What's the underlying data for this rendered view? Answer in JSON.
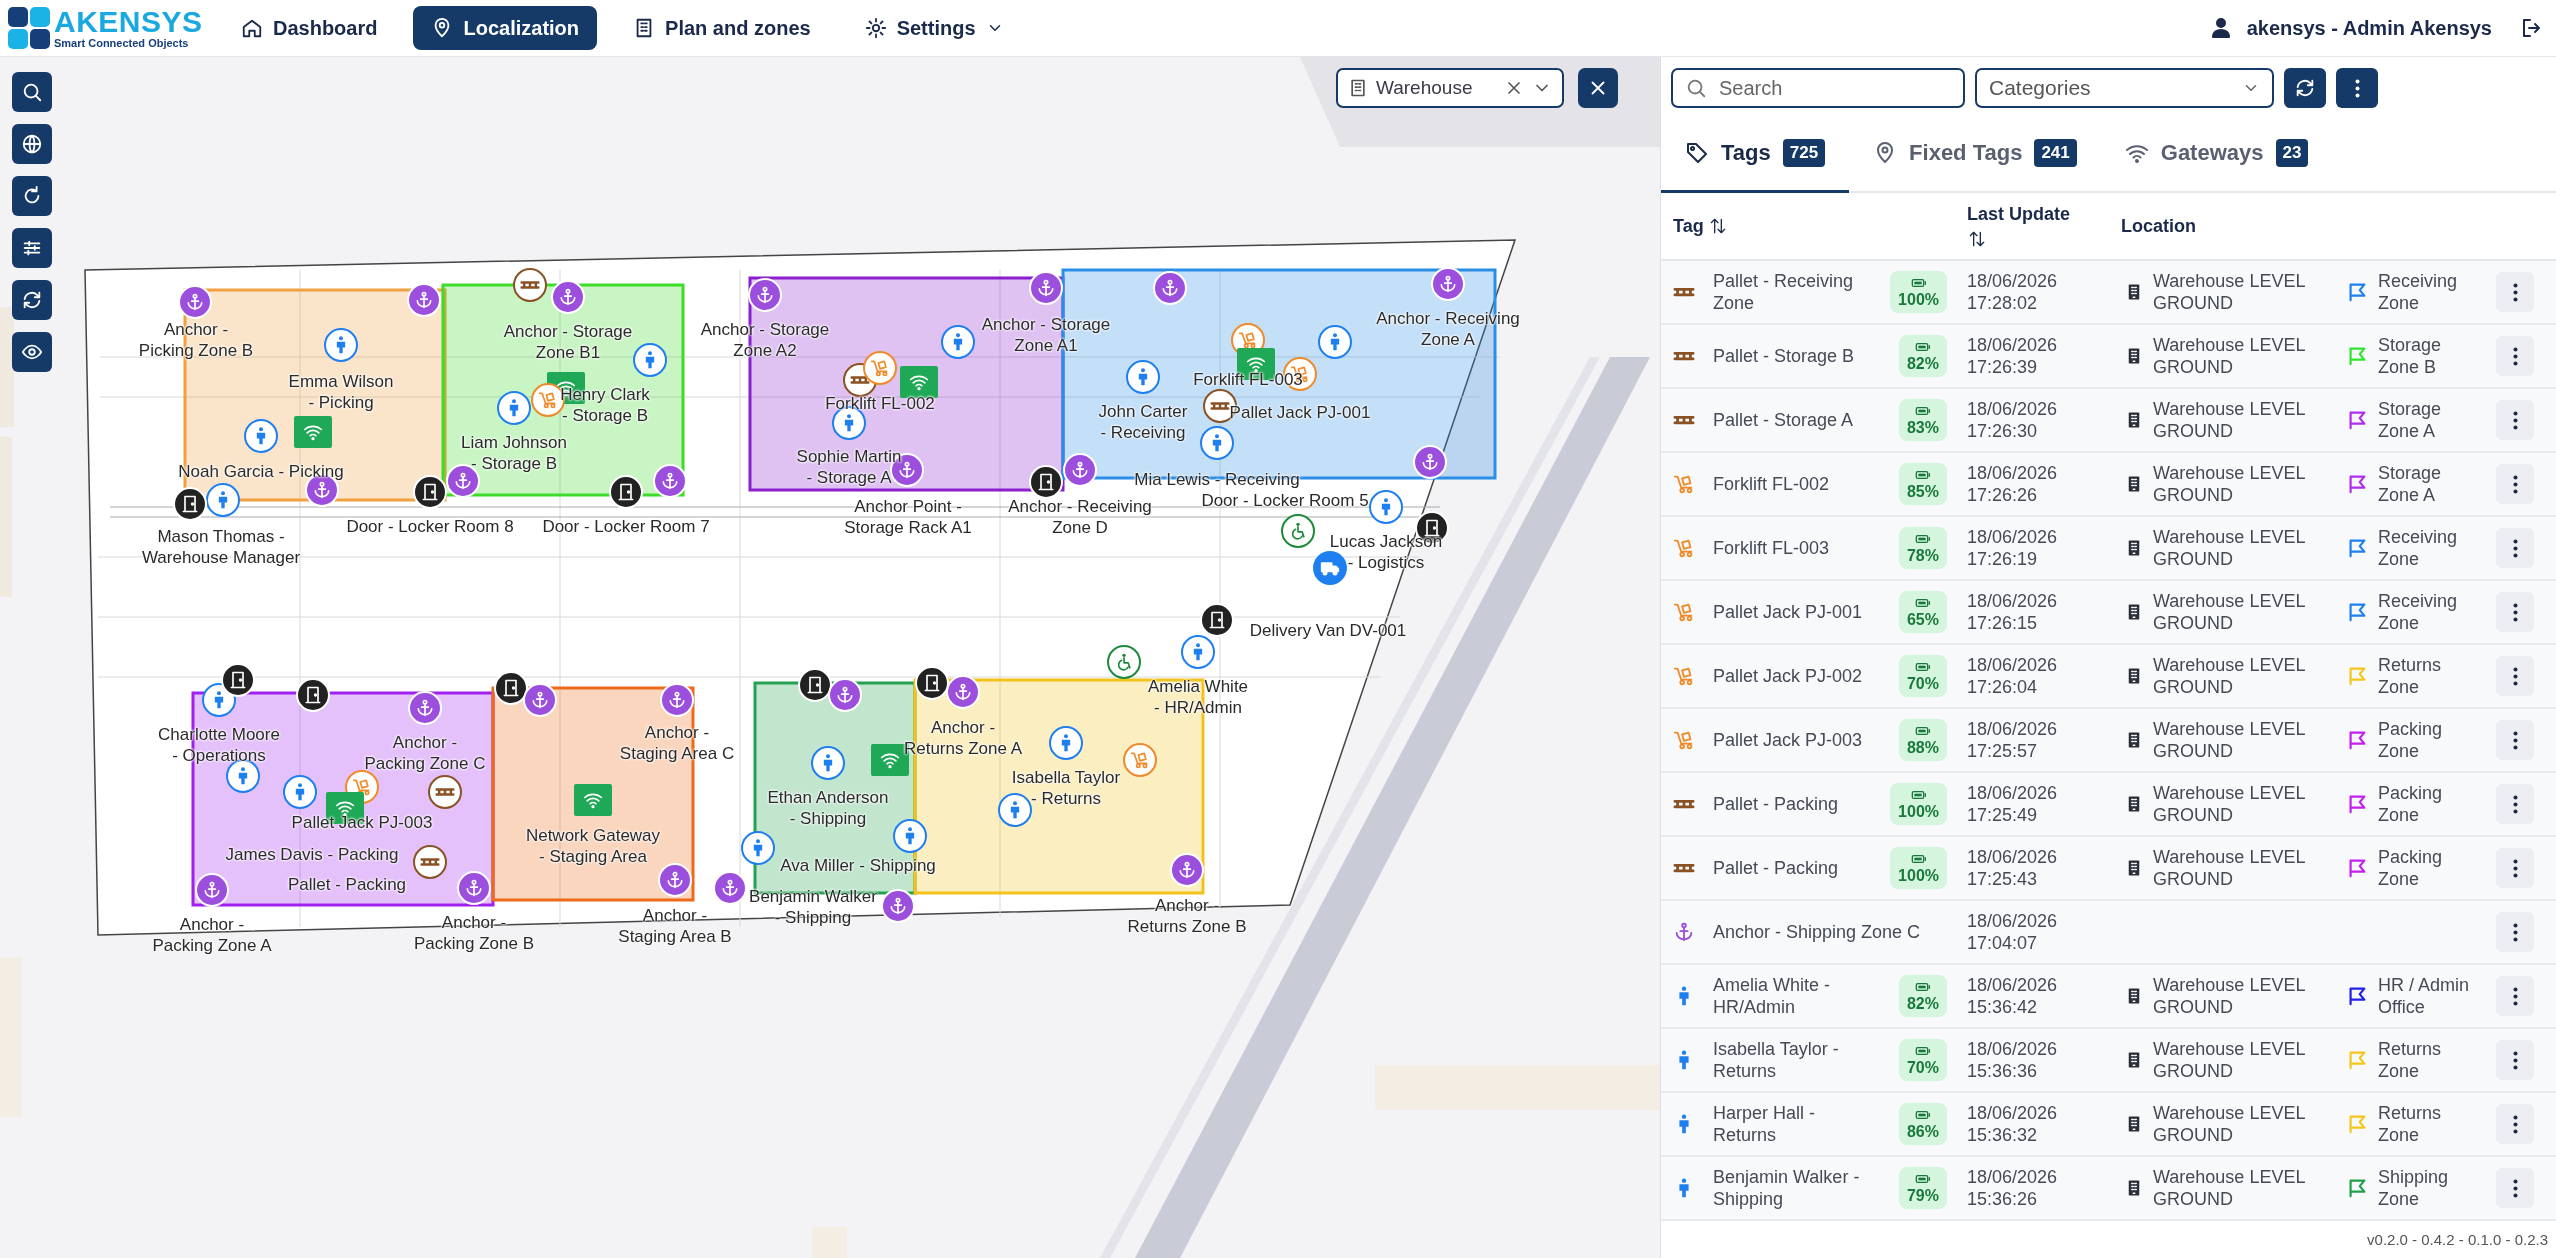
{
  "header": {
    "logo": {
      "name": "AKENSYS",
      "tagline": "Smart Connected Objects"
    },
    "nav": [
      {
        "kind": "home",
        "label": "Dashboard",
        "selected": false
      },
      {
        "kind": "pin",
        "label": "Localization",
        "selected": true
      },
      {
        "kind": "building",
        "label": "Plan and zones",
        "selected": false
      },
      {
        "kind": "gear",
        "label": "Settings",
        "selected": false,
        "dropdown": true
      }
    ],
    "user": "akensys - Admin Akensys"
  },
  "map_tools": [
    {
      "kind": "search"
    },
    {
      "kind": "globe"
    },
    {
      "kind": "rotate"
    },
    {
      "kind": "sliders"
    },
    {
      "kind": "sync"
    },
    {
      "kind": "eye"
    }
  ],
  "building_filter": {
    "value": "Warehouse"
  },
  "zones": [
    {
      "color": "#f0a040"
    },
    {
      "color": "#3ddc2a"
    },
    {
      "color": "#8b1fd0"
    },
    {
      "color": "#2a8de6"
    },
    {
      "color": "#a020f0"
    },
    {
      "color": "#ee6a1a"
    },
    {
      "color": "#23a050"
    },
    {
      "color": "#f2c21b"
    }
  ],
  "markers": [
    {
      "kind": "anchor",
      "label": "Anchor -\nPicking Zone B"
    },
    {
      "kind": "anchor",
      "label": "Anchor - Storage\nZone B1"
    },
    {
      "kind": "anchor",
      "label": "Anchor - Storage\nZone A2"
    },
    {
      "kind": "anchor",
      "label": "Anchor - Storage\nZone A1"
    },
    {
      "kind": "anchor",
      "label": "Anchor - Receiving\nZone A"
    },
    {
      "kind": "person",
      "label": "Emma Wilson\n- Picking"
    },
    {
      "kind": "person",
      "label": "Henry Clark\n- Storage B"
    },
    {
      "kind": "pallet",
      "label": "Forklift FL-002"
    },
    {
      "kind": "forklift",
      "label": "Forklift FL-003"
    },
    {
      "kind": "person",
      "label": "John Carter\n- Receiving"
    },
    {
      "kind": "pallet",
      "label": "Pallet Jack PJ-001"
    },
    {
      "kind": "person",
      "label": "Noah Garcia - Picking"
    },
    {
      "kind": "person",
      "label": "Liam Johnson\n- Storage B"
    },
    {
      "kind": "person",
      "label": "Sophie Martin\n- Storage A"
    },
    {
      "kind": "person",
      "label": "Mia Lewis - Receiving"
    },
    {
      "kind": "anchor",
      "label": "Anchor Point -\nStorage Rack A1"
    },
    {
      "kind": "anchor",
      "label": "Anchor - Receiving\nZone D"
    },
    {
      "kind": "door",
      "label": "Door - Locker Room 5"
    },
    {
      "kind": "person",
      "label": "Mason Thomas -\nWarehouse Manager"
    },
    {
      "kind": "door",
      "label": "Door - Locker Room 8"
    },
    {
      "kind": "door",
      "label": "Door - Locker Room 7"
    },
    {
      "kind": "person",
      "label": "Lucas Jackson\n- Logistics"
    },
    {
      "kind": "door",
      "label": "Delivery Van DV-001"
    },
    {
      "kind": "person",
      "label": "Amelia White\n- HR/Admin"
    },
    {
      "kind": "person",
      "label": "Charlotte Moore\n- Operations"
    },
    {
      "kind": "anchor",
      "label": "Anchor -\nPacking Zone C"
    },
    {
      "kind": "anchor",
      "label": "Anchor -\nStaging Area C"
    },
    {
      "kind": "anchor",
      "label": "Anchor -\nReturns Zone A"
    },
    {
      "kind": "person",
      "label": "Ethan Anderson\n- Shipping"
    },
    {
      "kind": "person",
      "label": "Isabella Taylor\n- Returns"
    },
    {
      "kind": "forklift",
      "label": "Pallet Jack PJ-003"
    },
    {
      "kind": "person",
      "label": "James Davis - Packing"
    },
    {
      "kind": "gateway",
      "label": "Network Gateway\n- Staging Area"
    },
    {
      "kind": "person",
      "label": "Ava Miller - Shipping"
    },
    {
      "kind": "pallet",
      "label": "Pallet - Packing"
    },
    {
      "kind": "anchor",
      "label": "Benjamin Walker\n- Shipping"
    },
    {
      "kind": "anchor",
      "label": "Anchor -\nPacking Zone A"
    },
    {
      "kind": "anchor",
      "label": "Anchor -\nPacking Zone B"
    },
    {
      "kind": "anchor",
      "label": "Anchor -\nStaging Area B"
    },
    {
      "kind": "anchor",
      "label": "Anchor -\nReturns Zone B"
    },
    {
      "kind": "pallet"
    },
    {
      "kind": "anchor"
    },
    {
      "kind": "anchor"
    },
    {
      "kind": "gateway"
    },
    {
      "kind": "person"
    },
    {
      "kind": "gateway"
    },
    {
      "kind": "forklift"
    },
    {
      "kind": "person"
    },
    {
      "kind": "forklift"
    },
    {
      "kind": "gateway"
    },
    {
      "kind": "gateway"
    },
    {
      "kind": "forklift"
    },
    {
      "kind": "person"
    },
    {
      "kind": "anchor"
    },
    {
      "kind": "anchor"
    },
    {
      "kind": "door"
    },
    {
      "kind": "anchor"
    },
    {
      "kind": "door"
    },
    {
      "kind": "anchor"
    },
    {
      "kind": "wheelchair"
    },
    {
      "kind": "truck"
    },
    {
      "kind": "wheelchair"
    },
    {
      "kind": "door"
    },
    {
      "kind": "door"
    },
    {
      "kind": "door"
    },
    {
      "kind": "anchor"
    },
    {
      "kind": "door"
    },
    {
      "kind": "anchor"
    },
    {
      "kind": "door"
    },
    {
      "kind": "person"
    },
    {
      "kind": "gateway"
    },
    {
      "kind": "pallet"
    },
    {
      "kind": "gateway"
    },
    {
      "kind": "forklift"
    },
    {
      "kind": "person"
    },
    {
      "kind": "anchor"
    }
  ],
  "panel": {
    "search": {
      "placeholder": "Search"
    },
    "categories": {
      "placeholder": "Categories"
    },
    "tabs": [
      {
        "kind": "tag",
        "label": "Tags",
        "count": "725",
        "selected": true
      },
      {
        "kind": "pin",
        "label": "Fixed Tags",
        "count": "241",
        "selected": false
      },
      {
        "kind": "wifi",
        "label": "Gateways",
        "count": "23",
        "selected": false
      }
    ],
    "columns": [
      "Tag",
      "Last Update",
      "Location"
    ],
    "rows": [
      {
        "kind": "pallet",
        "name": "Pallet - Receiving Zone",
        "battery": "100%",
        "updated": "18/06/2026 17:28:02",
        "location": "Warehouse LEVEL GROUND",
        "zone": "Receiving Zone",
        "color": "#1e7ff0"
      },
      {
        "kind": "pallet",
        "name": "Pallet - Storage B",
        "battery": "82%",
        "updated": "18/06/2026 17:26:39",
        "location": "Warehouse LEVEL GROUND",
        "zone": "Storage Zone B",
        "color": "#2ee52e"
      },
      {
        "kind": "pallet",
        "name": "Pallet - Storage A",
        "battery": "83%",
        "updated": "18/06/2026 17:26:30",
        "location": "Warehouse LEVEL GROUND",
        "zone": "Storage Zone A",
        "color": "#b02cf0"
      },
      {
        "kind": "forklift",
        "name": "Forklift FL-002",
        "battery": "85%",
        "updated": "18/06/2026 17:26:26",
        "location": "Warehouse LEVEL GROUND",
        "zone": "Storage Zone A",
        "color": "#b02cf0"
      },
      {
        "kind": "forklift",
        "name": "Forklift FL-003",
        "battery": "78%",
        "updated": "18/06/2026 17:26:19",
        "location": "Warehouse LEVEL GROUND",
        "zone": "Receiving Zone",
        "color": "#1e7ff0"
      },
      {
        "kind": "forklift",
        "name": "Pallet Jack PJ-001",
        "battery": "65%",
        "updated": "18/06/2026 17:26:15",
        "location": "Warehouse LEVEL GROUND",
        "zone": "Receiving Zone",
        "color": "#1e7ff0"
      },
      {
        "kind": "forklift",
        "name": "Pallet Jack PJ-002",
        "battery": "70%",
        "updated": "18/06/2026 17:26:04",
        "location": "Warehouse LEVEL GROUND",
        "zone": "Returns Zone",
        "color": "#f5c518"
      },
      {
        "kind": "forklift",
        "name": "Pallet Jack PJ-003",
        "battery": "88%",
        "updated": "18/06/2026 17:25:57",
        "location": "Warehouse LEVEL GROUND",
        "zone": "Packing Zone",
        "color": "#c21ff0"
      },
      {
        "kind": "pallet",
        "name": "Pallet - Packing",
        "battery": "100%",
        "updated": "18/06/2026 17:25:49",
        "location": "Warehouse LEVEL GROUND",
        "zone": "Packing Zone",
        "color": "#c21ff0"
      },
      {
        "kind": "pallet",
        "name": "Pallet - Packing",
        "battery": "100%",
        "updated": "18/06/2026 17:25:43",
        "location": "Warehouse LEVEL GROUND",
        "zone": "Packing Zone",
        "color": "#c21ff0"
      },
      {
        "kind": "anchor",
        "name": "Anchor - Shipping Zone C",
        "updated": "18/06/2026 17:04:07"
      },
      {
        "kind": "person",
        "name": "Amelia White - HR/Admin",
        "battery": "82%",
        "updated": "18/06/2026 15:36:42",
        "location": "Warehouse LEVEL GROUND",
        "zone": "HR / Admin Office",
        "color": "#2020e8"
      },
      {
        "kind": "person",
        "name": "Isabella Taylor - Returns",
        "battery": "70%",
        "updated": "18/06/2026 15:36:36",
        "location": "Warehouse LEVEL GROUND",
        "zone": "Returns Zone",
        "color": "#f5c518"
      },
      {
        "kind": "person",
        "name": "Harper Hall - Returns",
        "battery": "86%",
        "updated": "18/06/2026 15:36:32",
        "location": "Warehouse LEVEL GROUND",
        "zone": "Returns Zone",
        "color": "#f5c518"
      },
      {
        "kind": "person",
        "name": "Benjamin Walker - Shipping",
        "battery": "79%",
        "updated": "18/06/2026 15:36:26",
        "location": "Warehouse LEVEL GROUND",
        "zone": "Shipping Zone",
        "color": "#1fa04a"
      }
    ]
  },
  "version": "v0.2.0 - 0.4.2 - 0.1.0 - 0.2.3"
}
